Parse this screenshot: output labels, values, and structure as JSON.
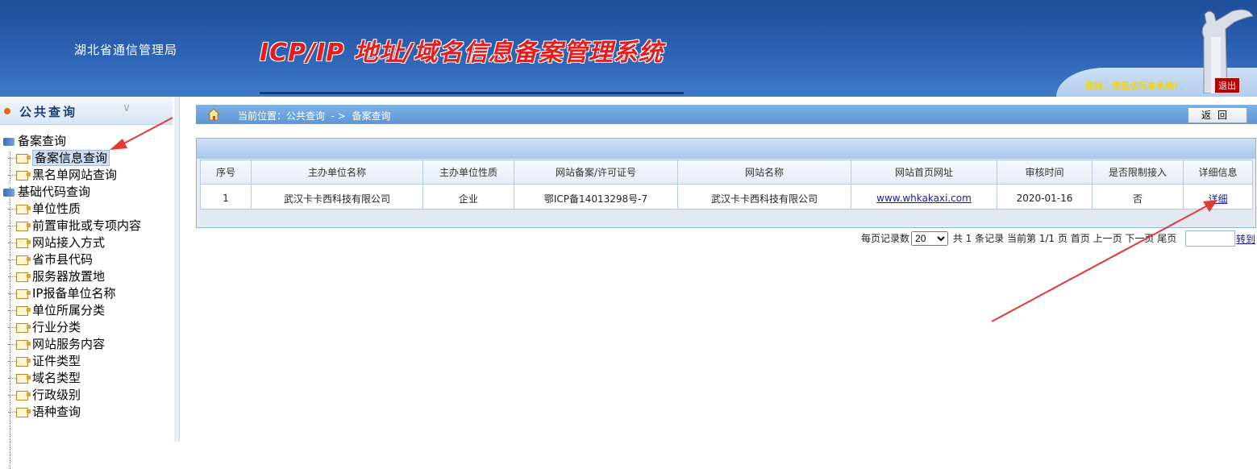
{
  "header": {
    "org": "湖北省通信管理局",
    "system_title": "ICP/IP 地址/域名信息备案管理系统",
    "greeting": "您好，欢迎访问本系统!",
    "logout_label": "退出"
  },
  "sidebar": {
    "section_title": "公共查询",
    "groups": [
      {
        "label": "备案查询",
        "items": [
          "备案信息查询",
          "黑名单网站查询"
        ]
      },
      {
        "label": "基础代码查询",
        "items": [
          "单位性质",
          "前置审批或专项内容",
          "网站接入方式",
          "省市县代码",
          "服务器放置地",
          "IP报备单位名称",
          "单位所属分类",
          "行业分类",
          "网站服务内容",
          "证件类型",
          "域名类型",
          "行政级别",
          "语种查询"
        ]
      }
    ],
    "selected_item": "备案信息查询"
  },
  "breadcrumb": {
    "label": "当前位置：公共查询",
    "separator": "- >",
    "current": "备案查询"
  },
  "back_button": "返回",
  "table": {
    "columns": [
      "序号",
      "主办单位名称",
      "主办单位性质",
      "网站备案/许可证号",
      "网站名称",
      "网站首页网址",
      "审核时间",
      "是否限制接入",
      "详细信息"
    ],
    "rows": [
      [
        "1",
        "武汉卡卡西科技有限公司",
        "企业",
        "鄂ICP备14013298号-7",
        "武汉卡卡西科技有限公司",
        "www.whkakaxi.com",
        "2020-01-16",
        "否",
        "详细"
      ]
    ]
  },
  "pager": {
    "per_page_label": "每页记录数",
    "per_page_value": "20",
    "total": "共 1 条记录",
    "current": "当前第 1/1 页",
    "first": "首页",
    "prev": "上一页",
    "next": "下一页",
    "last": "尾页",
    "go": "转到"
  },
  "colors": {
    "header_blue": "#2c62b4",
    "title_red": "#e21e1e",
    "annotation_red": "#e53935"
  }
}
